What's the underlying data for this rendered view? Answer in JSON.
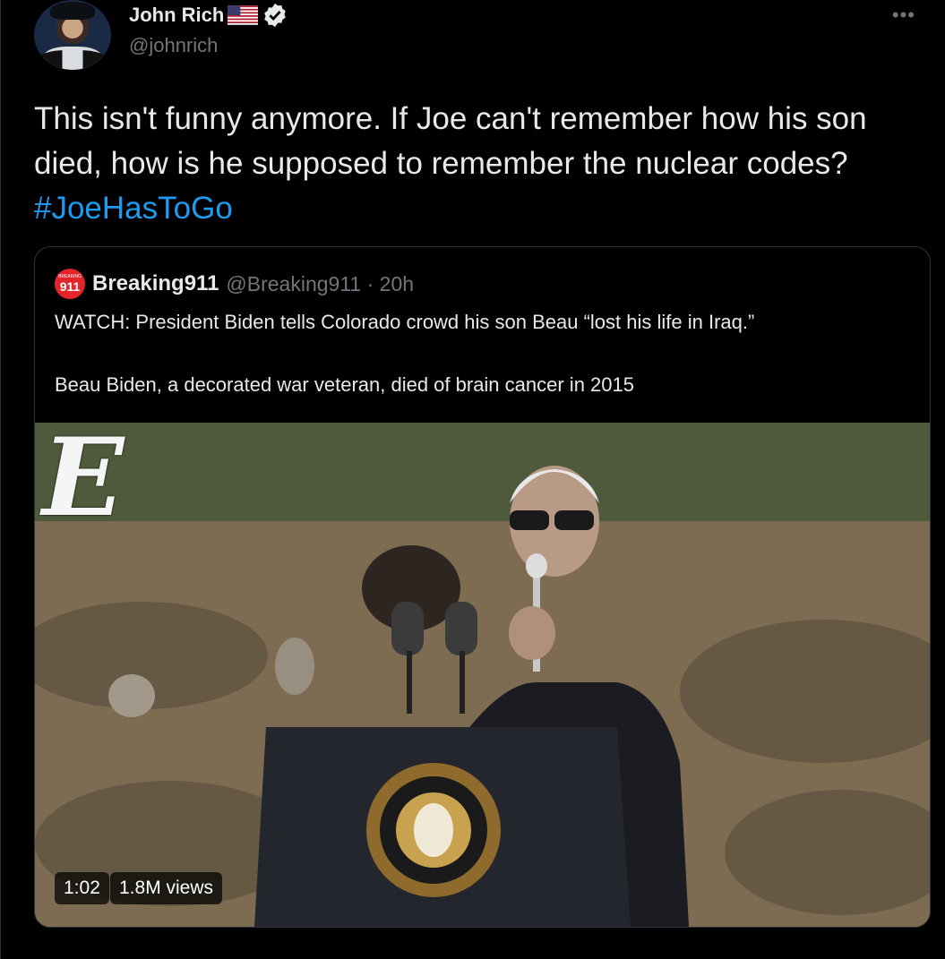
{
  "author": {
    "display_name": "John Rich",
    "handle": "@johnrich",
    "more_label": "•••",
    "flag_icon": "us-flag-icon",
    "verified_icon": "verified-badge-icon"
  },
  "tweet": {
    "text": "This isn't funny anymore. If Joe can't remember how his son died, how is he supposed to remember the nuclear codes? ",
    "hashtag": "#JoeHasToGo"
  },
  "quote": {
    "avatar_small": "BREAKING",
    "avatar_big": "911",
    "display_name": "Breaking911",
    "handle_time": "@Breaking911 · 20h",
    "text": "WATCH: President Biden tells Colorado crowd his son Beau “lost his life in Iraq.”\n\nBeau Biden, a decorated war veteran, died of brain cancer in 2015",
    "video": {
      "duration": "1:02",
      "views": "1.8M views",
      "watermark": "E"
    }
  },
  "colors": {
    "background": "#000000",
    "text": "#e7e9ea",
    "secondary": "#71767b",
    "link": "#1d9bf0",
    "border": "#2f3336",
    "brand_red": "#e3242b"
  }
}
